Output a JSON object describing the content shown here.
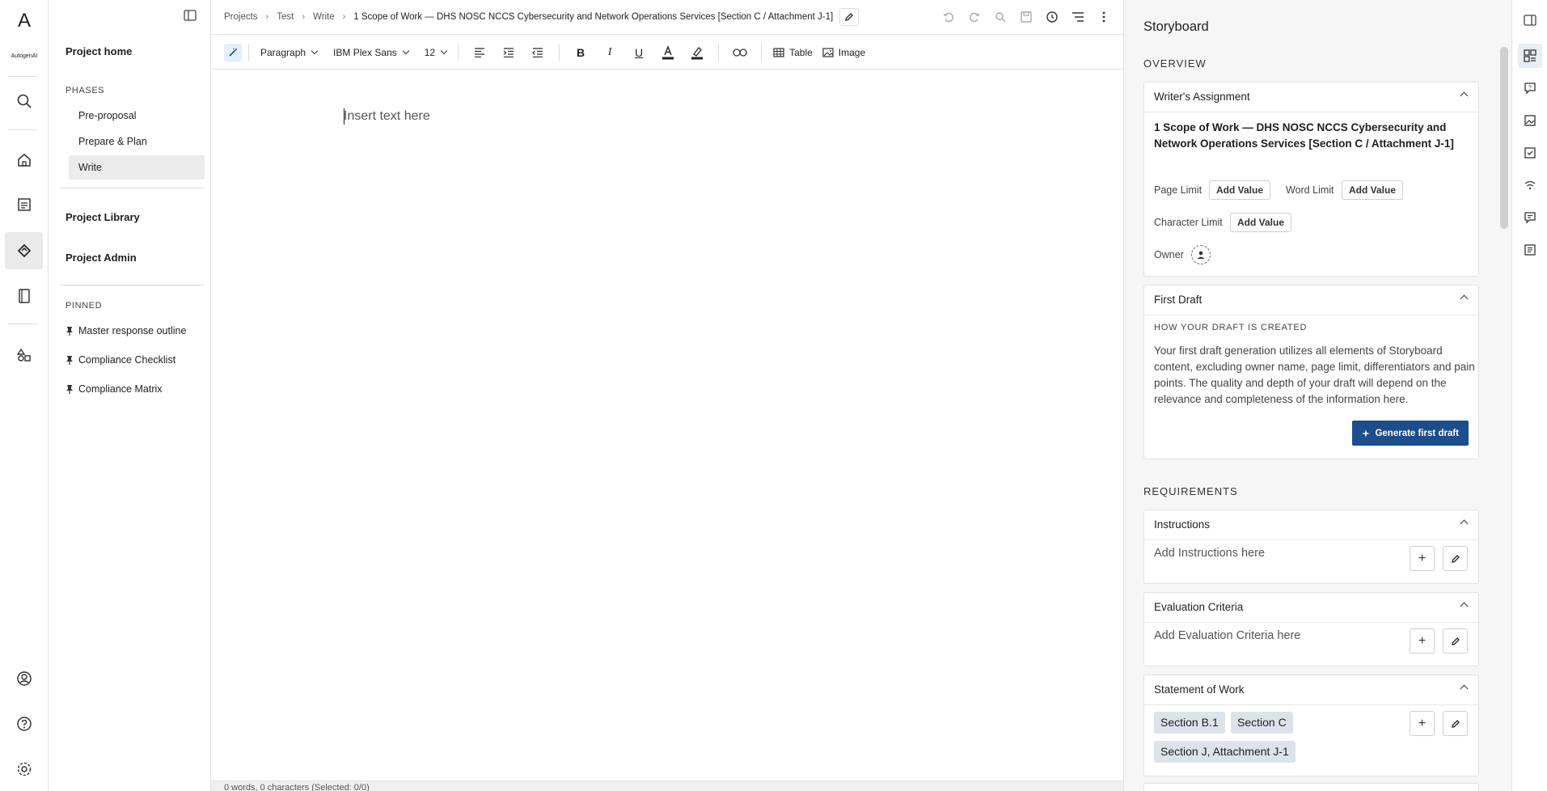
{
  "rail": {
    "logo": "A",
    "brand": "AutogenAI",
    "icons": [
      "search-icon",
      "home-icon",
      "document-icon",
      "proposal-icon",
      "library-icon",
      "shapes-icon",
      "account-icon",
      "help-icon",
      "settings-icon"
    ]
  },
  "nav": {
    "project_home": "Project home",
    "phases_header": "PHASES",
    "phases": [
      "Pre-proposal",
      "Prepare & Plan",
      "Write"
    ],
    "active_phase": "Write",
    "project_library": "Project Library",
    "project_admin": "Project Admin",
    "pinned_header": "PINNED",
    "pinned": [
      "Master response outline",
      "Compliance Checklist",
      "Compliance Matrix"
    ]
  },
  "breadcrumb": {
    "items": [
      "Projects",
      "Test",
      "Write"
    ],
    "current": "1 Scope of Work — DHS NOSC NCCS Cybersecurity and Network Operations Services [Section C / Attachment J-1]"
  },
  "toolbar": {
    "block_type": "Paragraph",
    "font": "IBM Plex Sans",
    "size": "12",
    "table_label": "Table",
    "image_label": "Image"
  },
  "editor": {
    "placeholder": "Insert text here",
    "status": "0 words, 0 characters (Selected: 0/0)"
  },
  "panel": {
    "title": "Storyboard",
    "overview": "OVERVIEW",
    "writers_assignment": {
      "title": "Writer's Assignment",
      "heading": "1 Scope of Work — DHS NOSC NCCS Cybersecurity and Network Operations Services [Section C / Attachment J-1]",
      "page_limit": "Page Limit",
      "word_limit": "Word Limit",
      "character_limit": "Character Limit",
      "add_value": "Add Value",
      "owner": "Owner"
    },
    "first_draft": {
      "title": "First Draft",
      "subheading": "HOW YOUR DRAFT IS CREATED",
      "text": "Your first draft generation utilizes all elements of Storyboard content, excluding owner name, page limit, differentiators and pain points. The quality and depth of your draft will depend on the relevance and completeness of the information here.",
      "button": "Generate first draft"
    },
    "requirements": "REQUIREMENTS",
    "instructions": {
      "title": "Instructions",
      "placeholder": "Add Instructions here"
    },
    "evaluation": {
      "title": "Evaluation Criteria",
      "placeholder": "Add Evaluation Criteria here"
    },
    "sow": {
      "title": "Statement of Work",
      "chips": [
        "Section B.1",
        "Section C",
        "Section J, Attachment J-1"
      ]
    }
  },
  "colors": {
    "primary_button": "#1c4d8c",
    "panel_bg": "#f6f6f6",
    "chip_bg": "#dde3ea"
  }
}
